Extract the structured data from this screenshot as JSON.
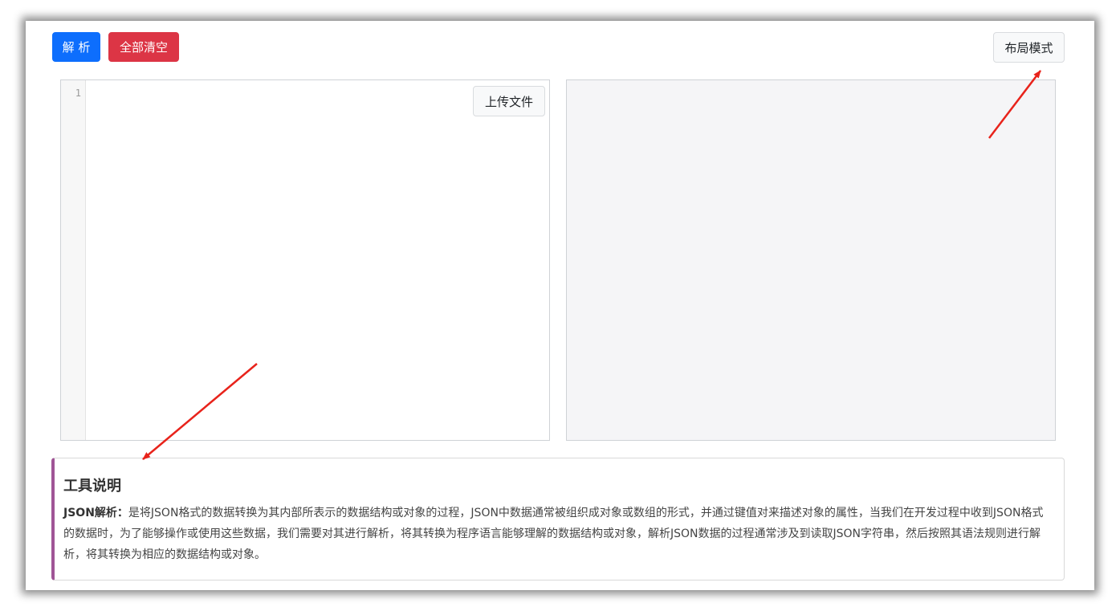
{
  "toolbar": {
    "parse_label": "解 析",
    "clear_label": "全部清空",
    "layout_label": "布局模式"
  },
  "editor": {
    "line_number": "1",
    "upload_label": "上传文件"
  },
  "info": {
    "title": "工具说明",
    "term": "JSON解析：",
    "description": "是将JSON格式的数据转换为其内部所表示的数据结构或对象的过程，JSON中数据通常被组织成对象或数组的形式，并通过键值对来描述对象的属性，当我们在开发过程中收到JSON格式的数据时，为了能够操作或使用这些数据，我们需要对其进行解析，将其转换为程序语言能够理解的数据结构或对象，解析JSON数据的过程通常涉及到读取JSON字符串，然后按照其语法规则进行解析，将其转换为相应的数据结构或对象。"
  },
  "colors": {
    "primary": "#0d6efd",
    "danger": "#dc3545",
    "info_accent": "#a05596",
    "annotation_arrow": "#e8231b"
  }
}
